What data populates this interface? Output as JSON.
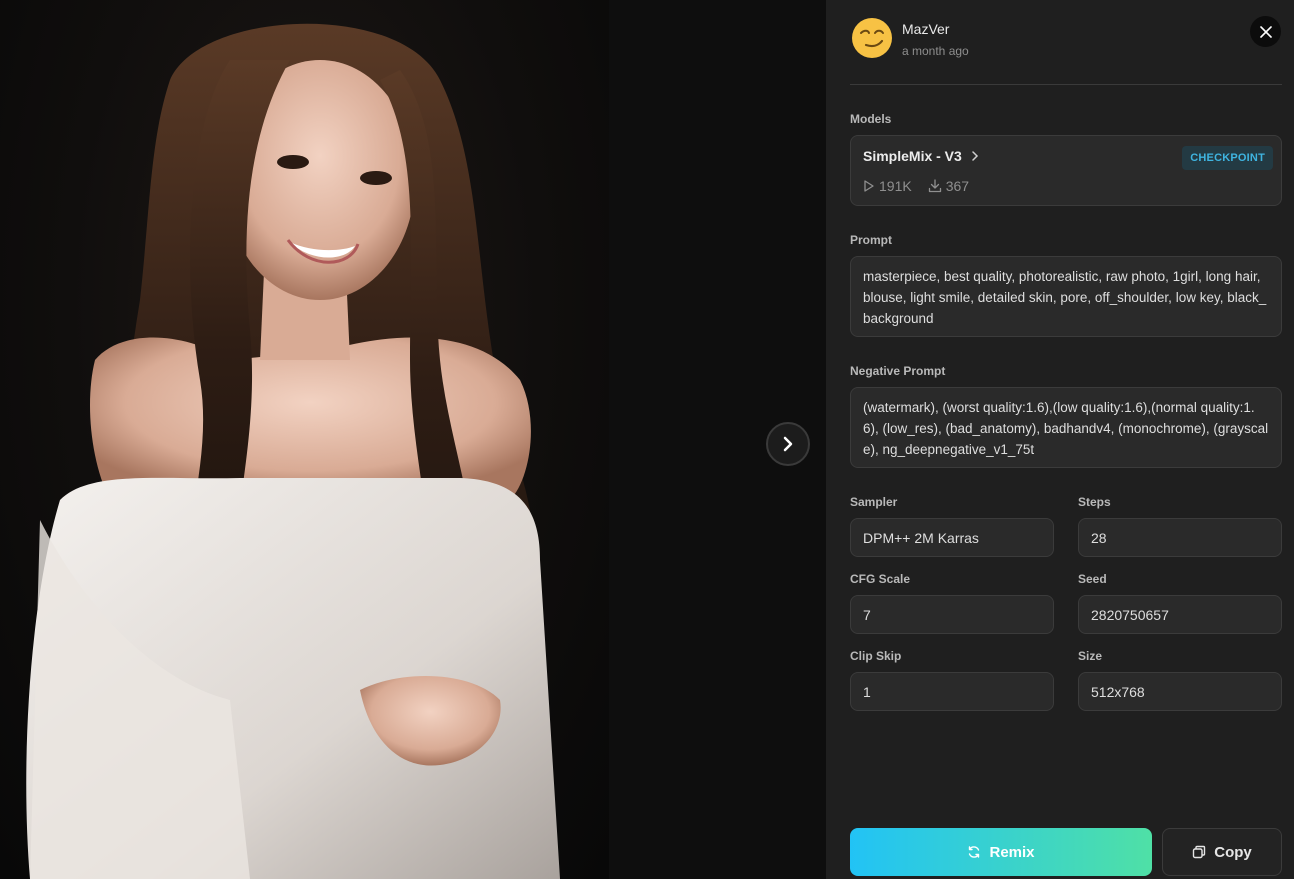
{
  "author": {
    "name": "MazVer",
    "time": "a month ago",
    "avatar_icon": "smirking-face-icon"
  },
  "viewer": {
    "next_icon": "chevron-right-icon",
    "image_description_icon": "generated-portrait-image"
  },
  "close_icon": "close-icon",
  "models": {
    "label": "Models",
    "name": "SimpleMix - V3",
    "type": "CHECKPOINT",
    "runs": "191K",
    "downloads": "367"
  },
  "prompt": {
    "label": "Prompt",
    "text": "masterpiece, best quality, photorealistic, raw photo, 1girl, long hair, blouse, light smile, detailed skin, pore, off_shoulder, low key, black_background"
  },
  "negative_prompt": {
    "label": "Negative Prompt",
    "text": "(watermark), (worst quality:1.6),(low quality:1.6),(normal quality:1.6), (low_res), (bad_anatomy), badhandv4, (monochrome), (grayscale), ng_deepnegative_v1_75t"
  },
  "params": {
    "sampler_label": "Sampler",
    "sampler": "DPM++ 2M Karras",
    "steps_label": "Steps",
    "steps": "28",
    "cfg_label": "CFG Scale",
    "cfg": "7",
    "seed_label": "Seed",
    "seed": "2820750657",
    "clip_skip_label": "Clip Skip",
    "clip_skip": "1",
    "size_label": "Size",
    "size": "512x768"
  },
  "actions": {
    "remix": "Remix",
    "copy": "Copy"
  },
  "colors": {
    "panel_bg": "#1f1f1f",
    "accent_start": "#22c3f5",
    "accent_end": "#4fe0a6",
    "checkpoint_text": "#3fb4e0"
  }
}
